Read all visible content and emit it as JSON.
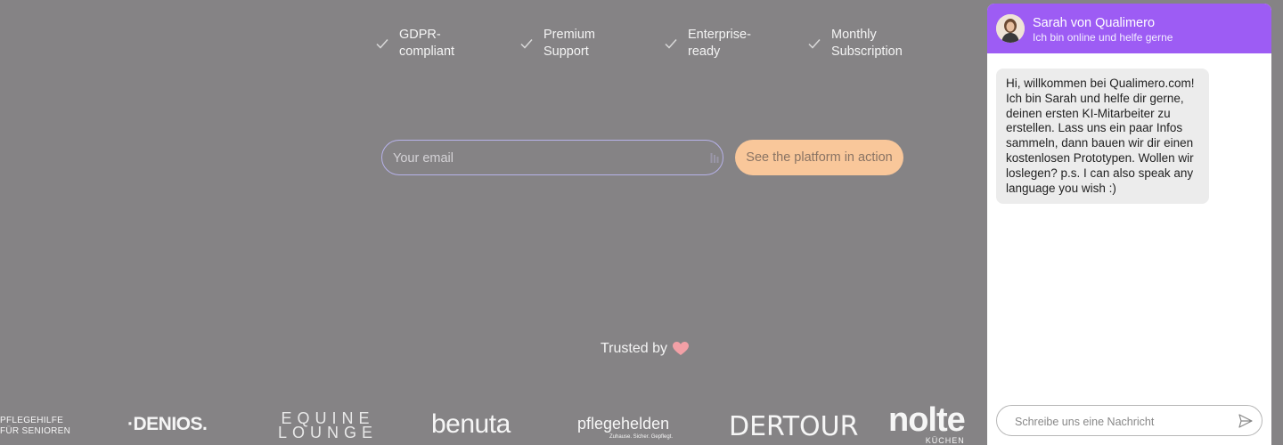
{
  "features": [
    {
      "label": "GDPR-\ncompliant",
      "icon": "check-icon"
    },
    {
      "label": "Premium\nSupport",
      "icon": "check-icon"
    },
    {
      "label": "Enterprise-\nready",
      "icon": "check-icon"
    },
    {
      "label": "Monthly\nSubscription",
      "icon": "check-icon"
    }
  ],
  "signup": {
    "email_placeholder": "Your email",
    "email_value": "",
    "cta_label": "See the platform in action"
  },
  "trusted": {
    "label": "Trusted by",
    "icon": "heart-icon"
  },
  "logos": {
    "pflegehilfe_line1": "PFLEGEHILFE",
    "pflegehilfe_line2": "FÜR SENIOREN",
    "denios": "·DENIOS.",
    "equine_line1": "EQUINE",
    "equine_line2": "LOUNGE",
    "benuta": "benuta",
    "pflegehelden": "pflegehelden",
    "pflegehelden_tag": "Zuhause. Sicher. Gepflegt.",
    "dertour": "DERTOUR",
    "nolte": "nolte",
    "nolte_sub": "KÜCHEN"
  },
  "chat": {
    "agent_name": "Sarah von Qualimero",
    "agent_status": "Ich bin online und helfe gerne",
    "message": "Hi, willkommen bei Qualimero.com! Ich bin Sarah und helfe dir gerne, deinen ersten KI-Mitarbeiter zu erstellen. Lass uns ein paar Infos sammeln, dann bauen wir dir einen kostenlosen Prototypen. Wollen wir loslegen? p.s. I can also speak any language you wish :)",
    "input_placeholder": "Schreibe uns eine Nachricht",
    "header_color": "#9d5cf4"
  },
  "colors": {
    "page_bg": "#858385",
    "cta_bg": "#f9c79a",
    "heart": "#f2a0a6"
  }
}
